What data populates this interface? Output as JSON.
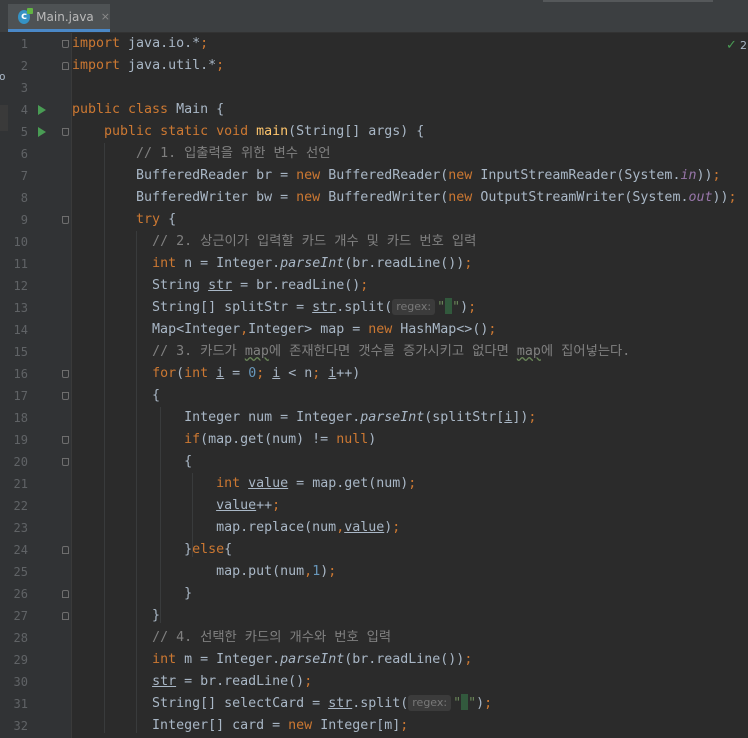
{
  "tab": {
    "label": "Main.java",
    "icon": "java-class-icon",
    "icon_letter": "c",
    "close": "×"
  },
  "left_clip": {
    "char": "o"
  },
  "inspection": {
    "icon": "check-icon",
    "glyph": "✓",
    "count": "2"
  },
  "colors": {
    "background": "#2b2b2b",
    "keyword": "#cc7832",
    "comment": "#808080",
    "method": "#ffc66d",
    "static_field": "#9876aa",
    "number": "#6897bb",
    "text": "#a9b7c6"
  },
  "lines": [
    {
      "n": "1",
      "fold": "down",
      "segs": [
        [
          "kw",
          "import "
        ],
        [
          "",
          "java.io.*"
        ],
        [
          "kw",
          ";"
        ]
      ]
    },
    {
      "n": "2",
      "fold": "up",
      "segs": [
        [
          "kw",
          "import "
        ],
        [
          "",
          "java.util.*"
        ],
        [
          "kw",
          ";"
        ]
      ]
    },
    {
      "n": "3",
      "segs": []
    },
    {
      "n": "4",
      "run": true,
      "segs": [
        [
          "kw",
          "public class "
        ],
        [
          "",
          "Main {"
        ]
      ]
    },
    {
      "n": "5",
      "run": true,
      "fold": "down",
      "segs": [
        [
          "",
          "    "
        ],
        [
          "kw",
          "public static void "
        ],
        [
          "fn",
          "main"
        ],
        [
          "",
          "(String[] args) {"
        ]
      ]
    },
    {
      "n": "6",
      "segs": [
        [
          "",
          "        "
        ],
        [
          "cm",
          "// 1. 입출력을 위한 변수 선언"
        ]
      ]
    },
    {
      "n": "7",
      "segs": [
        [
          "",
          "        BufferedReader br = "
        ],
        [
          "kw",
          "new "
        ],
        [
          "",
          "BufferedReader("
        ],
        [
          "kw",
          "new "
        ],
        [
          "",
          "InputStreamReader(System."
        ],
        [
          "st",
          "in"
        ],
        [
          "",
          "))"
        ],
        [
          "kw",
          ";"
        ]
      ]
    },
    {
      "n": "8",
      "segs": [
        [
          "",
          "        BufferedWriter bw = "
        ],
        [
          "kw",
          "new "
        ],
        [
          "",
          "BufferedWriter("
        ],
        [
          "kw",
          "new "
        ],
        [
          "",
          "OutputStreamWriter(System."
        ],
        [
          "st",
          "out"
        ],
        [
          "",
          "))"
        ],
        [
          "kw",
          ";"
        ]
      ]
    },
    {
      "n": "9",
      "fold": "down",
      "segs": [
        [
          "",
          "        "
        ],
        [
          "kw",
          "try "
        ],
        [
          "",
          "{"
        ]
      ]
    },
    {
      "n": "10",
      "segs": [
        [
          "",
          "          "
        ],
        [
          "cm",
          "// 2. 상근이가 입력할 카드 개수 및 카드 번호 입력"
        ]
      ]
    },
    {
      "n": "11",
      "segs": [
        [
          "",
          "          "
        ],
        [
          "kw",
          "int "
        ],
        [
          "",
          "n = Integer."
        ],
        [
          "it",
          "parseInt"
        ],
        [
          "",
          "(br.readLine())"
        ],
        [
          "kw",
          ";"
        ]
      ]
    },
    {
      "n": "12",
      "segs": [
        [
          "",
          "          String "
        ],
        [
          "u",
          "str"
        ],
        [
          "",
          " = br.readLine()"
        ],
        [
          "kw",
          ";"
        ]
      ]
    },
    {
      "n": "13",
      "segs": [
        [
          "",
          "          String[] splitStr = "
        ],
        [
          "u",
          "str"
        ],
        [
          "",
          ".split("
        ],
        [
          "hint",
          "regex:"
        ],
        [
          "strlit",
          "\""
        ],
        [
          "caret",
          ""
        ],
        [
          "strlit",
          "\""
        ],
        [
          "",
          ")"
        ],
        [
          "kw",
          ";"
        ]
      ]
    },
    {
      "n": "14",
      "segs": [
        [
          "",
          "          Map<Integer"
        ],
        [
          "kw",
          ","
        ],
        [
          "",
          "Integer> map = "
        ],
        [
          "kw",
          "new "
        ],
        [
          "",
          "HashMap<>()"
        ],
        [
          "kw",
          ";"
        ]
      ]
    },
    {
      "n": "15",
      "segs": [
        [
          "",
          "          "
        ],
        [
          "cm",
          "// 3. 카드가 "
        ],
        [
          "cmsq",
          "map"
        ],
        [
          "cm",
          "에 존재한다면 갯수를 증가시키고 없다면 "
        ],
        [
          "cmsq",
          "map"
        ],
        [
          "cm",
          "에 집어넣는다."
        ]
      ]
    },
    {
      "n": "16",
      "fold": "down",
      "segs": [
        [
          "",
          "          "
        ],
        [
          "kw",
          "for"
        ],
        [
          "",
          "("
        ],
        [
          "kw",
          "int "
        ],
        [
          "u",
          "i"
        ],
        [
          "",
          " = "
        ],
        [
          "num",
          "0"
        ],
        [
          "kw",
          "; "
        ],
        [
          "u",
          "i"
        ],
        [
          "",
          " < n"
        ],
        [
          "kw",
          "; "
        ],
        [
          "u",
          "i"
        ],
        [
          "",
          "++)"
        ]
      ]
    },
    {
      "n": "17",
      "fold": "down",
      "segs": [
        [
          "",
          "          {"
        ]
      ]
    },
    {
      "n": "18",
      "segs": [
        [
          "",
          "              Integer num = Integer."
        ],
        [
          "it",
          "parseInt"
        ],
        [
          "",
          "(splitStr["
        ],
        [
          "u",
          "i"
        ],
        [
          "",
          "])"
        ],
        [
          "kw",
          ";"
        ]
      ]
    },
    {
      "n": "19",
      "fold": "down",
      "segs": [
        [
          "",
          "              "
        ],
        [
          "kw",
          "if"
        ],
        [
          "",
          "(map.get(num) != "
        ],
        [
          "kw",
          "null"
        ],
        [
          "",
          ")"
        ]
      ]
    },
    {
      "n": "20",
      "fold": "down",
      "segs": [
        [
          "",
          "              {"
        ]
      ]
    },
    {
      "n": "21",
      "segs": [
        [
          "",
          "                  "
        ],
        [
          "kw",
          "int "
        ],
        [
          "u",
          "value"
        ],
        [
          "",
          " = map.get(num)"
        ],
        [
          "kw",
          ";"
        ]
      ]
    },
    {
      "n": "22",
      "segs": [
        [
          "",
          "                  "
        ],
        [
          "u",
          "value"
        ],
        [
          "",
          "++"
        ],
        [
          "kw",
          ";"
        ]
      ]
    },
    {
      "n": "23",
      "segs": [
        [
          "",
          "                  map.replace(num"
        ],
        [
          "kw",
          ","
        ],
        [
          "u",
          "value"
        ],
        [
          "",
          ")"
        ],
        [
          "kw",
          ";"
        ]
      ]
    },
    {
      "n": "24",
      "fold": "up",
      "segs": [
        [
          "",
          "              }"
        ],
        [
          "kw",
          "else"
        ],
        [
          "",
          "{"
        ]
      ]
    },
    {
      "n": "25",
      "segs": [
        [
          "",
          "                  map.put(num"
        ],
        [
          "kw",
          ","
        ],
        [
          "num",
          "1"
        ],
        [
          "",
          ")"
        ],
        [
          "kw",
          ";"
        ]
      ]
    },
    {
      "n": "26",
      "fold": "up",
      "segs": [
        [
          "",
          "              }"
        ]
      ]
    },
    {
      "n": "27",
      "fold": "up",
      "segs": [
        [
          "",
          "          }"
        ]
      ]
    },
    {
      "n": "28",
      "segs": [
        [
          "",
          "          "
        ],
        [
          "cm",
          "// 4. 선택한 카드의 개수와 번호 입력"
        ]
      ]
    },
    {
      "n": "29",
      "segs": [
        [
          "",
          "          "
        ],
        [
          "kw",
          "int "
        ],
        [
          "",
          "m = Integer."
        ],
        [
          "it",
          "parseInt"
        ],
        [
          "",
          "(br.readLine())"
        ],
        [
          "kw",
          ";"
        ]
      ]
    },
    {
      "n": "30",
      "segs": [
        [
          "",
          "          "
        ],
        [
          "u",
          "str"
        ],
        [
          "",
          " = br.readLine()"
        ],
        [
          "kw",
          ";"
        ]
      ]
    },
    {
      "n": "31",
      "segs": [
        [
          "",
          "          String[] selectCard = "
        ],
        [
          "u",
          "str"
        ],
        [
          "",
          ".split("
        ],
        [
          "hint",
          "regex:"
        ],
        [
          "strlit",
          "\""
        ],
        [
          "caret",
          ""
        ],
        [
          "strlit",
          "\""
        ],
        [
          "",
          ")"
        ],
        [
          "kw",
          ";"
        ]
      ]
    },
    {
      "n": "32",
      "segs": [
        [
          "",
          "          Integer[] card = "
        ],
        [
          "kw",
          "new "
        ],
        [
          "",
          "Integer[m]"
        ],
        [
          "kw",
          ";"
        ]
      ]
    }
  ]
}
